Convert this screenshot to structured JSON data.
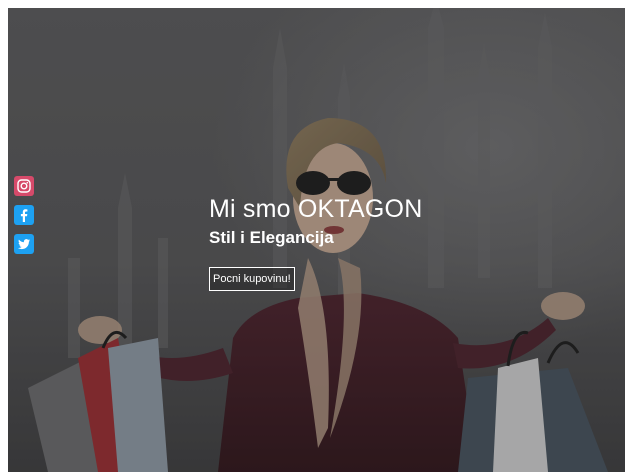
{
  "hero": {
    "title": "Mi smo OKTAGON",
    "subtitle": "Stil i Elegancija",
    "cta_label": "Pocni kupovinu!"
  },
  "social": {
    "icons": [
      "instagram-icon",
      "facebook-icon",
      "twitter-icon"
    ],
    "colors": {
      "instagram": "#e1306c",
      "facebook": "#1da1f2",
      "twitter": "#1da1f2"
    }
  }
}
